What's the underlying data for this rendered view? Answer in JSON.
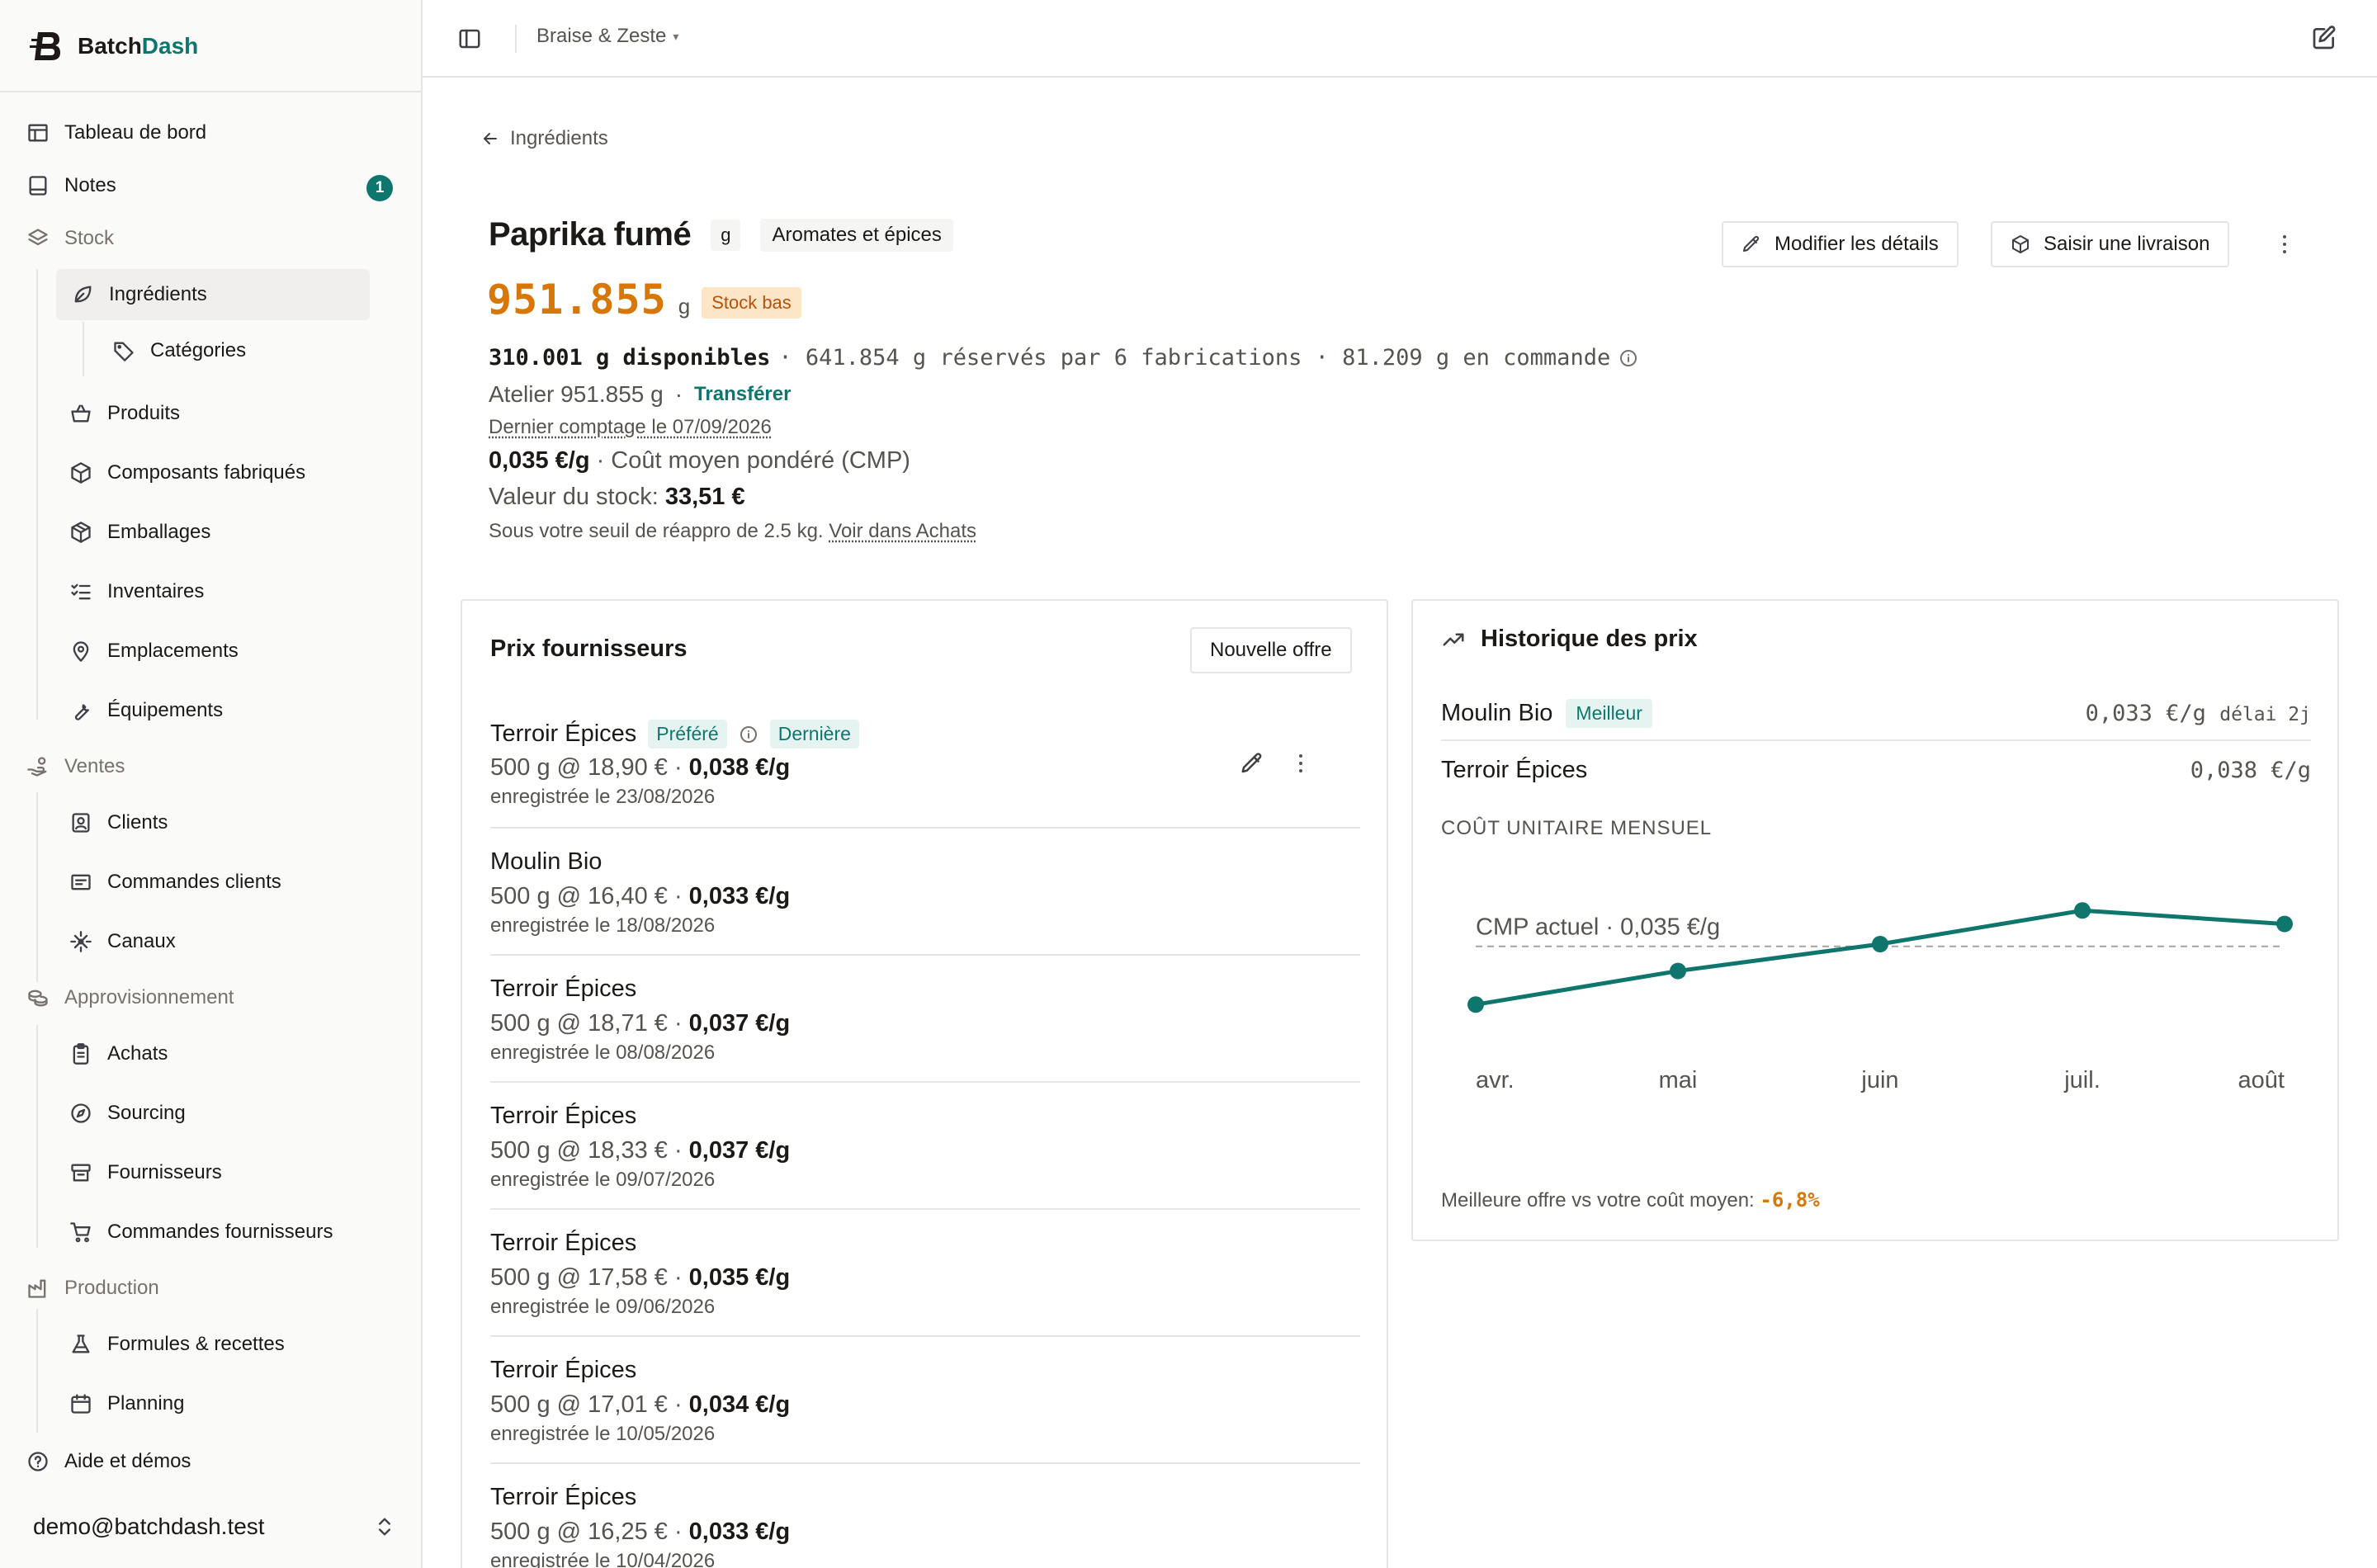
{
  "brand": {
    "name_part1": "Batch",
    "name_part2": "Dash"
  },
  "sidebar": {
    "items": [
      {
        "label": "Tableau de bord"
      },
      {
        "label": "Notes",
        "badge": "1"
      },
      {
        "label": "Stock"
      },
      {
        "label": "Ingrédients"
      },
      {
        "label": "Catégories"
      },
      {
        "label": "Produits"
      },
      {
        "label": "Composants fabriqués"
      },
      {
        "label": "Emballages"
      },
      {
        "label": "Inventaires"
      },
      {
        "label": "Emplacements"
      },
      {
        "label": "Équipements"
      },
      {
        "label": "Ventes"
      },
      {
        "label": "Clients"
      },
      {
        "label": "Commandes clients"
      },
      {
        "label": "Canaux"
      },
      {
        "label": "Approvisionnement"
      },
      {
        "label": "Achats"
      },
      {
        "label": "Sourcing"
      },
      {
        "label": "Fournisseurs"
      },
      {
        "label": "Commandes fournisseurs"
      },
      {
        "label": "Production"
      },
      {
        "label": "Formules & recettes"
      },
      {
        "label": "Planning"
      },
      {
        "label": "Aide et démos"
      }
    ],
    "user_email": "demo@batchdash.test"
  },
  "topbar": {
    "workspace": "Braise & Zeste"
  },
  "header": {
    "back_label": "Ingrédients",
    "title": "Paprika fumé",
    "unit_tag": "g",
    "category_tag": "Aromates et épices",
    "stock_value": "951.855",
    "stock_unit": "g",
    "stock_status": "Stock bas",
    "available": "310.001 g disponibles",
    "reserved": "· 641.854 g réservés par 6 fabrications · 81.209 g en commande",
    "location": "Atelier 951.855 g",
    "transfer_link": "Transférer",
    "last_count": "Dernier comptage le 07/09/2026",
    "cmp_value": "0,035 €/g",
    "cmp_label": "· Coût moyen pondéré (CMP)",
    "stock_value_label": "Valeur du stock:",
    "stock_value_amount": "33,51 €",
    "threshold_text": "Sous votre seuil de réappro de 2.5 kg.",
    "threshold_link": "Voir dans Achats",
    "edit_button": "Modifier les détails",
    "delivery_button": "Saisir une livraison"
  },
  "suppliers": {
    "title": "Prix fournisseurs",
    "new_offer_button": "Nouvelle offre",
    "offers": [
      {
        "supplier": "Terroir Épices",
        "tags": [
          "Préféré",
          "Dernière"
        ],
        "price_text": "500 g @ 18,90 € ·",
        "unit_price": "0,038 €/g",
        "date": "enregistrée le 23/08/2026"
      },
      {
        "supplier": "Moulin Bio",
        "price_text": "500 g @ 16,40 € ·",
        "unit_price": "0,033 €/g",
        "date": "enregistrée le 18/08/2026"
      },
      {
        "supplier": "Terroir Épices",
        "price_text": "500 g @ 18,71 € ·",
        "unit_price": "0,037 €/g",
        "date": "enregistrée le 08/08/2026"
      },
      {
        "supplier": "Terroir Épices",
        "price_text": "500 g @ 18,33 € ·",
        "unit_price": "0,037 €/g",
        "date": "enregistrée le 09/07/2026"
      },
      {
        "supplier": "Terroir Épices",
        "price_text": "500 g @ 17,58 € ·",
        "unit_price": "0,035 €/g",
        "date": "enregistrée le 09/06/2026"
      },
      {
        "supplier": "Terroir Épices",
        "price_text": "500 g @ 17,01 € ·",
        "unit_price": "0,034 €/g",
        "date": "enregistrée le 10/05/2026"
      },
      {
        "supplier": "Terroir Épices",
        "price_text": "500 g @ 16,25 € ·",
        "unit_price": "0,033 €/g",
        "date": "enregistrée le 10/04/2026"
      }
    ]
  },
  "history": {
    "title": "Historique des prix",
    "rows": [
      {
        "supplier": "Moulin Bio",
        "tag": "Meilleur",
        "value": "0,033 €/g",
        "extra": "délai 2j"
      },
      {
        "supplier": "Terroir Épices",
        "value": "0,038 €/g"
      }
    ],
    "section_label": "COÛT UNITAIRE MENSUEL",
    "footnote_label": "Meilleure offre vs votre coût moyen:",
    "footnote_value": "-6,8%"
  },
  "chart_data": {
    "type": "line",
    "categories": [
      "avr.",
      "mai",
      "juin",
      "juil.",
      "août"
    ],
    "values": [
      0.0325,
      0.034,
      0.0352,
      0.0367,
      0.0361
    ],
    "ylim": [
      0.031,
      0.038
    ],
    "reference_value": 0.0351,
    "reference_label": "CMP actuel · 0,035 €/g",
    "line_color": "#0f766e",
    "grid": false
  },
  "colors": {
    "accent": "#0f766e",
    "warning": "#d97706"
  }
}
